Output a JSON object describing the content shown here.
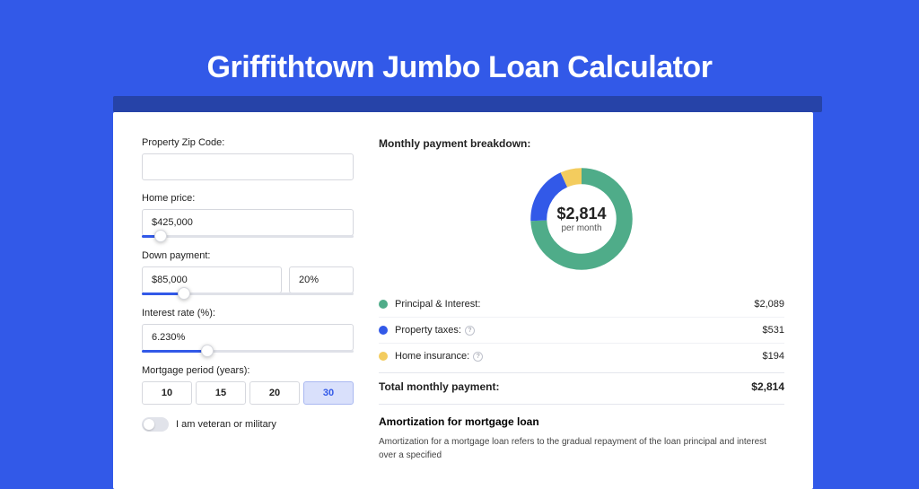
{
  "title": "Griffithtown Jumbo Loan Calculator",
  "form": {
    "zip": {
      "label": "Property Zip Code:",
      "value": ""
    },
    "price": {
      "label": "Home price:",
      "value": "$425,000",
      "slider_fill_pct": 9,
      "thumb_pct": 9
    },
    "down": {
      "label": "Down payment:",
      "amount": "$85,000",
      "pct": "20%",
      "slider_fill_pct": 20,
      "thumb_pct": 20
    },
    "rate": {
      "label": "Interest rate (%):",
      "value": "6.230%",
      "slider_fill_pct": 31,
      "thumb_pct": 31
    },
    "term": {
      "label": "Mortgage period (years):",
      "options": [
        "10",
        "15",
        "20",
        "30"
      ],
      "active_index": 3
    },
    "veteran": {
      "label": "I am veteran or military",
      "checked": false
    }
  },
  "breakdown": {
    "title": "Monthly payment breakdown:",
    "total_value": "$2,814",
    "total_sub": "per month",
    "items": [
      {
        "label": "Principal & Interest:",
        "value": "$2,089",
        "color": "#4fac89",
        "info": false,
        "numeric": 2089
      },
      {
        "label": "Property taxes:",
        "value": "$531",
        "color": "#3259e8",
        "info": true,
        "numeric": 531
      },
      {
        "label": "Home insurance:",
        "value": "$194",
        "color": "#f3cc5e",
        "info": true,
        "numeric": 194
      }
    ],
    "total_label": "Total monthly payment:",
    "total_display": "$2,814"
  },
  "chart_data": {
    "type": "pie",
    "title": "Monthly payment breakdown",
    "categories": [
      "Principal & Interest",
      "Property taxes",
      "Home insurance"
    ],
    "values": [
      2089,
      531,
      194
    ],
    "colors": [
      "#4fac89",
      "#3259e8",
      "#f3cc5e"
    ],
    "center_label": "$2,814",
    "center_sub": "per month"
  },
  "amortization": {
    "title": "Amortization for mortgage loan",
    "body": "Amortization for a mortgage loan refers to the gradual repayment of the loan principal and interest over a specified"
  }
}
